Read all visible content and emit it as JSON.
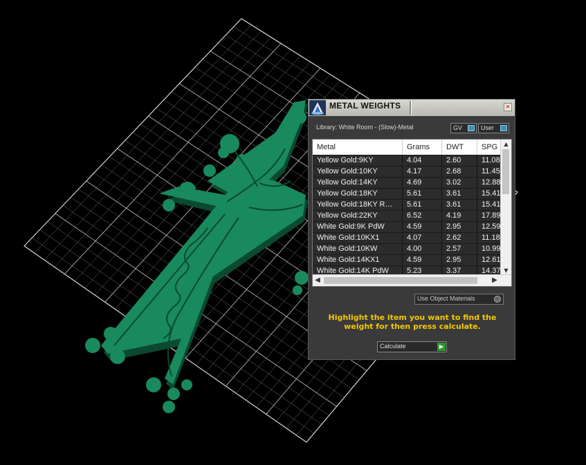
{
  "viewport": {
    "grid_color": "#d0d0d0",
    "model_color": "#19895e",
    "model_dark": "#0b4a30",
    "background": "#000000"
  },
  "panel": {
    "title": "METAL WEIGHTS",
    "close_label": "×",
    "library_label": "Library: White Room - (Slow)-Metal",
    "gv_label": "GV",
    "user_label": "User",
    "table": {
      "columns": [
        "Metal",
        "Grams",
        "DWT",
        "SPG"
      ],
      "rows": [
        [
          "Yellow Gold:9KY",
          "4.04",
          "2.60",
          "11.08"
        ],
        [
          "Yellow Gold:10KY",
          "4.17",
          "2.68",
          "11.45"
        ],
        [
          "Yellow Gold:14KY",
          "4.69",
          "3.02",
          "12.88"
        ],
        [
          "Yellow Gold:18KY",
          "5.61",
          "3.61",
          "15.41"
        ],
        [
          "Yellow Gold:18KY R…",
          "5.61",
          "3.61",
          "15.41"
        ],
        [
          "Yellow Gold:22KY",
          "6.52",
          "4.19",
          "17.89"
        ],
        [
          "White Gold:9K PdW",
          "4.59",
          "2.95",
          "12.59"
        ],
        [
          "White Gold:10KX1",
          "4.07",
          "2.62",
          "11.18"
        ],
        [
          "White Gold:10KW",
          "4.00",
          "2.57",
          "10.99"
        ],
        [
          "White Gold:14KX1",
          "4.59",
          "2.95",
          "12.61"
        ],
        [
          "White Gold:14K PdW",
          "5.23",
          "3.37",
          "14.37"
        ]
      ]
    },
    "use_object_materials_label": "Use Object Materials",
    "instruction": "Highlight the item you want to find the weight for then press calculate.",
    "calculate_label": "Calculate",
    "accent_color": "#f2c800"
  }
}
